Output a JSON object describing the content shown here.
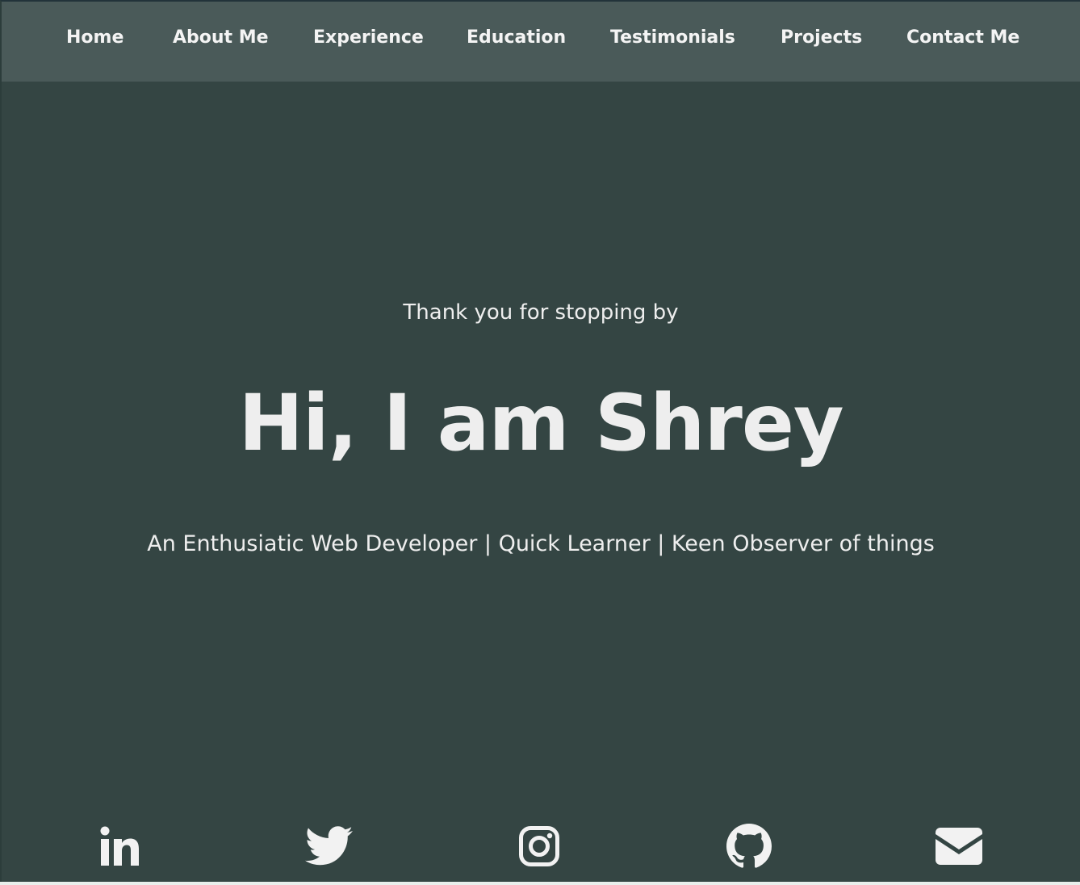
{
  "nav": {
    "items": [
      {
        "label": "Home"
      },
      {
        "label": "About Me"
      },
      {
        "label": "Experience"
      },
      {
        "label": "Education"
      },
      {
        "label": "Testimonials"
      },
      {
        "label": "Projects"
      },
      {
        "label": "Contact Me"
      }
    ]
  },
  "hero": {
    "greeting": "Thank you for stopping by",
    "title": "Hi, I am Shrey",
    "tagline": "An Enthusiatic Web Developer | Quick Learner | Keen Observer of things"
  },
  "social": [
    {
      "icon": "linkedin-icon"
    },
    {
      "icon": "twitter-icon"
    },
    {
      "icon": "instagram-icon"
    },
    {
      "icon": "github-icon"
    },
    {
      "icon": "email-icon"
    }
  ],
  "colors": {
    "background": "#344543",
    "navbar": "#4a5a59",
    "text": "#eeeeee"
  }
}
